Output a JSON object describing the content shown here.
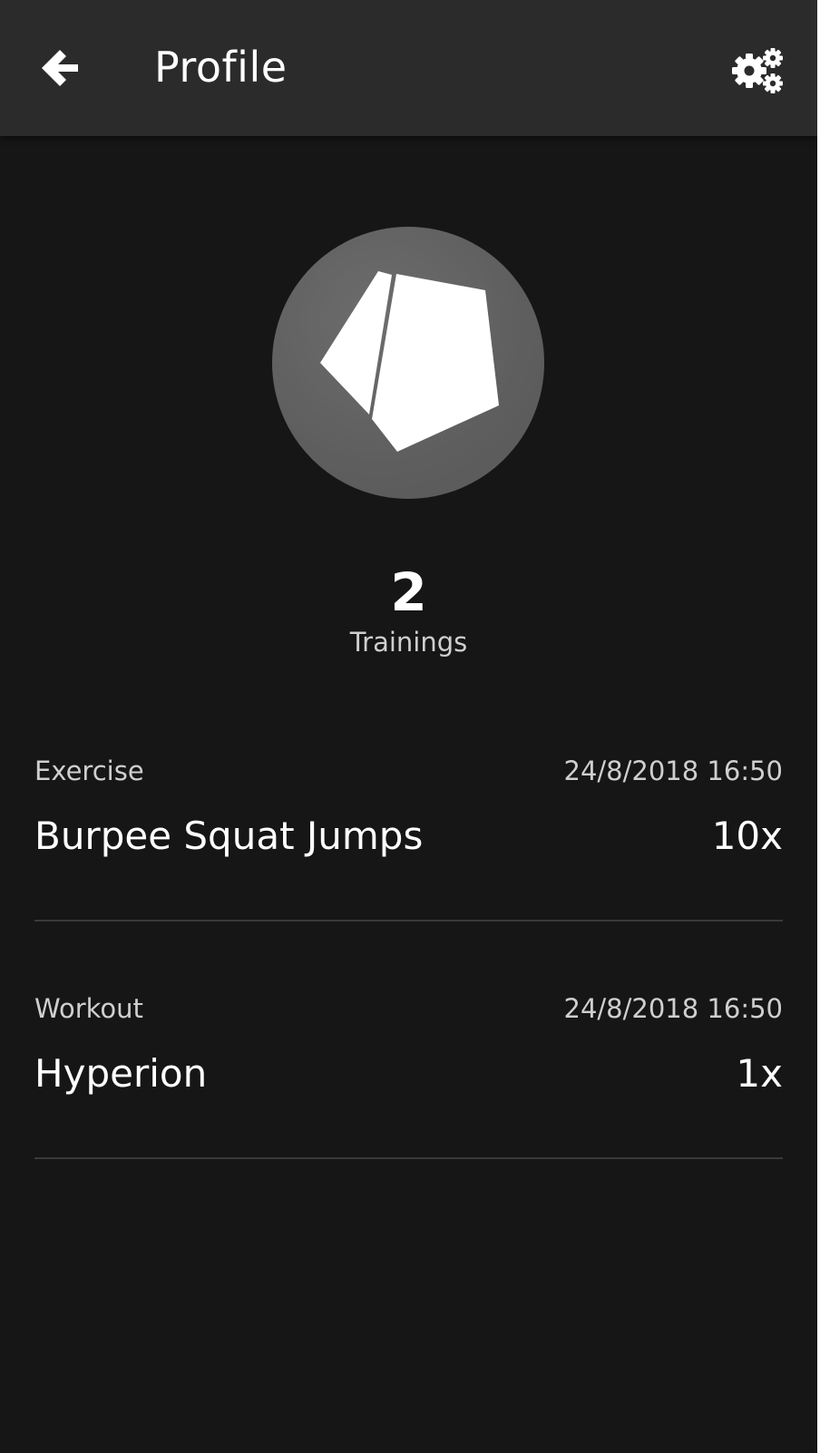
{
  "header": {
    "title": "Profile",
    "back_icon": "arrow-left-icon",
    "settings_icon": "gears-icon"
  },
  "avatar": {
    "icon": "pentagon-logo-icon"
  },
  "stats": {
    "count": "2",
    "label": "Trainings"
  },
  "trainings": [
    {
      "type": "Exercise",
      "date": "24/8/2018 16:50",
      "name": "Burpee Squat Jumps",
      "count": "10x"
    },
    {
      "type": "Workout",
      "date": "24/8/2018 16:50",
      "name": "Hyperion",
      "count": "1x"
    }
  ],
  "colors": {
    "background": "#161616",
    "topbar": "#2b2b2b",
    "divider": "#3a3a3a",
    "avatar": "#5e5e5e"
  }
}
